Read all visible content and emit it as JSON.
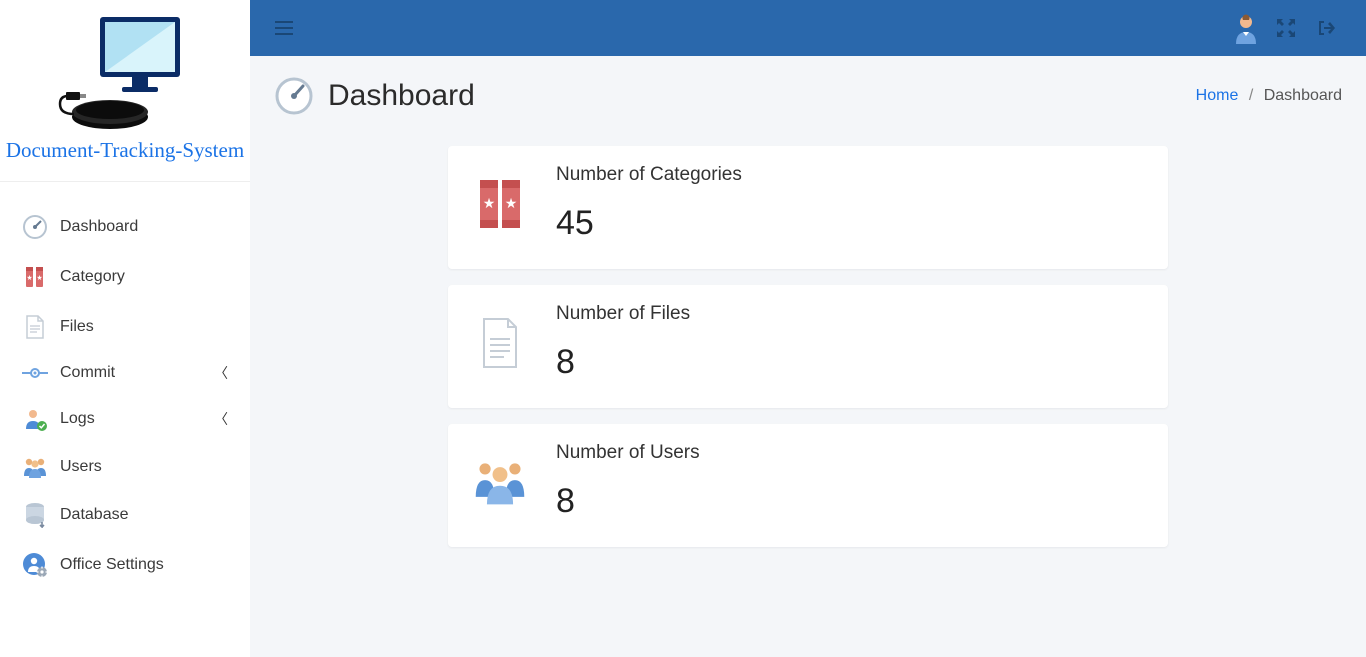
{
  "app_name": "Document-Tracking-System",
  "topbar": {
    "menu_toggle": "menu",
    "fullscreen": "fullscreen",
    "logout": "logout"
  },
  "page": {
    "title": "Dashboard"
  },
  "breadcrumb": {
    "home_label": "Home",
    "current": "Dashboard"
  },
  "sidebar": {
    "items": [
      {
        "id": "dashboard",
        "label": "Dashboard",
        "expandable": false
      },
      {
        "id": "category",
        "label": "Category",
        "expandable": false
      },
      {
        "id": "files",
        "label": "Files",
        "expandable": false
      },
      {
        "id": "commit",
        "label": "Commit",
        "expandable": true
      },
      {
        "id": "logs",
        "label": "Logs",
        "expandable": true
      },
      {
        "id": "users",
        "label": "Users",
        "expandable": false
      },
      {
        "id": "database",
        "label": "Database",
        "expandable": false
      },
      {
        "id": "office",
        "label": "Office Settings",
        "expandable": false
      }
    ]
  },
  "cards": [
    {
      "id": "categories",
      "label": "Number of Categories",
      "value": "45"
    },
    {
      "id": "files",
      "label": "Number of Files",
      "value": "8"
    },
    {
      "id": "users",
      "label": "Number of Users",
      "value": "8"
    }
  ],
  "icons": {
    "dashboard": "gauge",
    "category": "medals",
    "files": "doc",
    "commit": "node",
    "logs": "person-check",
    "users": "people",
    "database": "db",
    "office": "gear-person"
  }
}
